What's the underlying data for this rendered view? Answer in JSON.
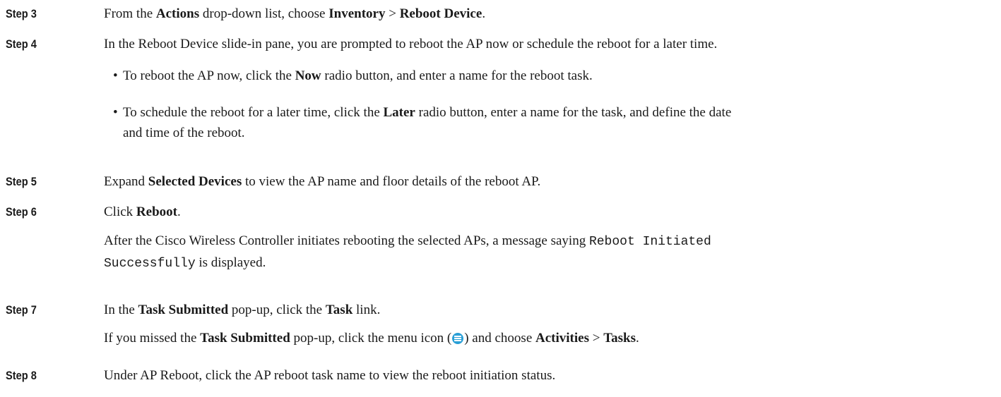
{
  "steps": [
    {
      "label": "Step 3",
      "t1": "From the ",
      "b1": "Actions",
      "t2": " drop-down list, choose ",
      "b2": "Inventory",
      "t3": " > ",
      "b3": "Reboot Device",
      "t4": "."
    },
    {
      "label": "Step 4",
      "text": "In the Reboot Device slide-in pane, you are prompted to reboot the AP now or schedule the reboot for a later time.",
      "bullet1": {
        "dot": "•",
        "t1": "To reboot the AP now, click the ",
        "b1": "Now",
        "t2": " radio button, and enter a name for the reboot task."
      },
      "bullet2": {
        "dot": "•",
        "t1": "To schedule the reboot for a later time, click the ",
        "b1": "Later",
        "t2": " radio button, enter a name for the task, and define the date",
        "t3": "and time of the reboot."
      }
    },
    {
      "label": "Step 5",
      "t1": "Expand ",
      "b1": "Selected Devices",
      "t2": " to view the AP name and floor details of the reboot AP."
    },
    {
      "label": "Step 6",
      "t1": "Click ",
      "b1": "Reboot",
      "t2": ".",
      "note": {
        "t1": "After the Cisco Wireless Controller initiates rebooting the selected APs, a message saying ",
        "m1": "Reboot Initiated",
        "m2": "Successfully",
        "t2": " is displayed."
      }
    },
    {
      "label": "Step 7",
      "t1": "In the ",
      "b1": "Task Submitted",
      "t2": " pop-up, click the ",
      "b2": "Task",
      "t3": " link.",
      "note": {
        "t1": "If you missed the ",
        "b1": "Task Submitted",
        "t2": " pop-up, click the menu icon (",
        "icon": "menu-icon",
        "t3": ") and choose ",
        "b2": "Activities",
        "t4": " > ",
        "b3": "Tasks",
        "t5": "."
      }
    },
    {
      "label": "Step 8",
      "text": "Under AP Reboot, click the AP reboot task name to view the reboot initiation status."
    }
  ]
}
